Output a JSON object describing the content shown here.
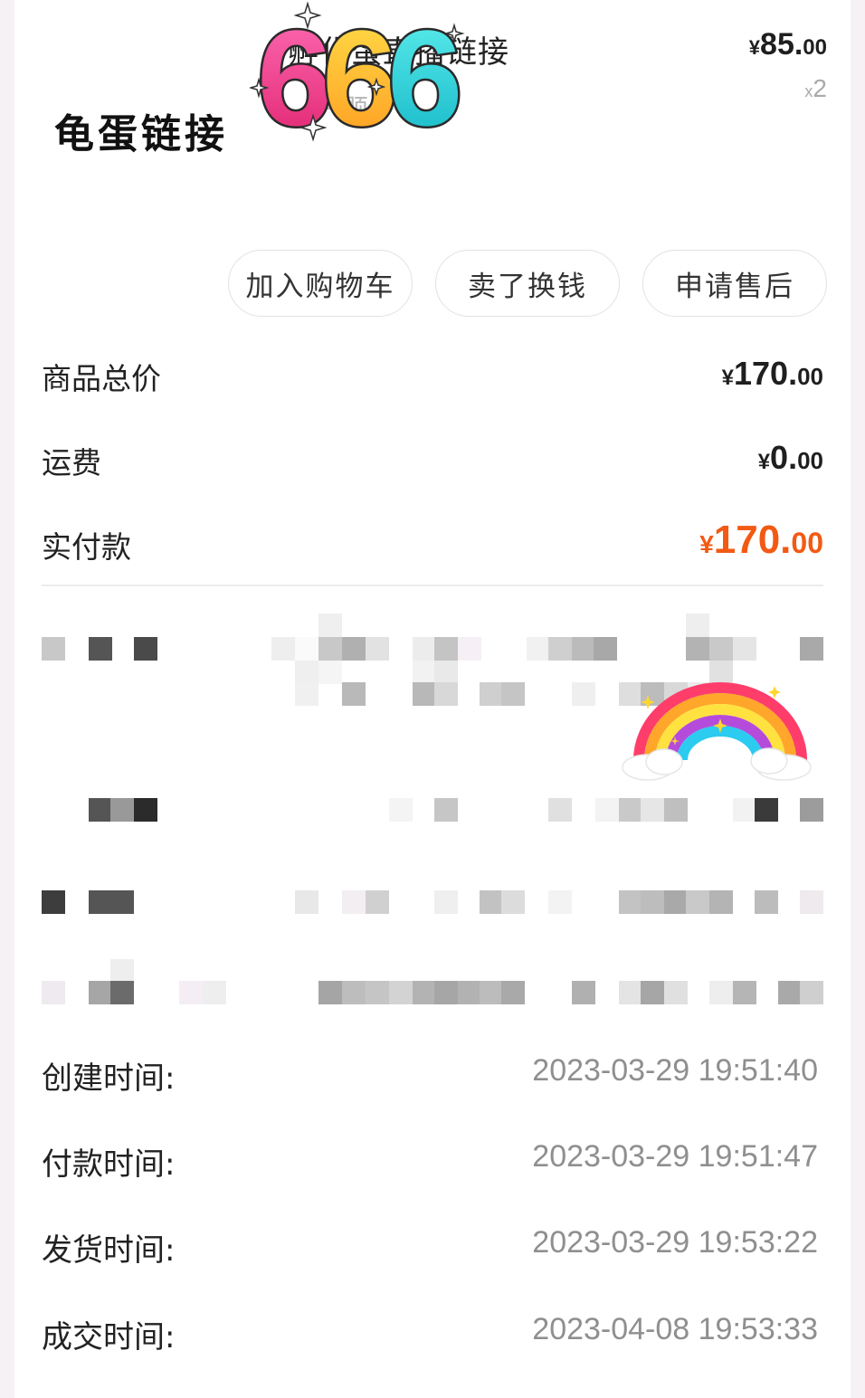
{
  "product": {
    "title": "孵化蛋直播链接",
    "spec": "一颗",
    "price_currency": "¥",
    "price_int": "85.",
    "price_dec": "00",
    "quantity_prefix": "x",
    "quantity": "2"
  },
  "stickers": {
    "handwritten": "龟蛋链接",
    "big_number": "666"
  },
  "actions": {
    "add_to_cart": "加入购物车",
    "sell_for_cash": "卖了换钱",
    "after_sales": "申请售后"
  },
  "summary": {
    "goods_total_label": "商品总价",
    "goods_total_cur": "¥",
    "goods_total_int": "170.",
    "goods_total_dec": "00",
    "shipping_label": "运费",
    "shipping_cur": "¥",
    "shipping_int": "0.",
    "shipping_dec": "00",
    "paid_label": "实付款",
    "paid_cur": "¥",
    "paid_int": "170.",
    "paid_dec": "00"
  },
  "times": {
    "created_label": "创建时间:",
    "created_value": "2023-03-29 19:51:40",
    "paid_label": "付款时间:",
    "paid_value": "2023-03-29 19:51:47",
    "shipped_label": "发货时间:",
    "shipped_value": "2023-03-29 19:53:22",
    "completed_label": "成交时间:",
    "completed_value": "2023-04-08 19:53:33"
  },
  "colors": {
    "accent_price": "#f25a14",
    "text_primary": "#222222",
    "text_muted": "#8f8f8f"
  }
}
